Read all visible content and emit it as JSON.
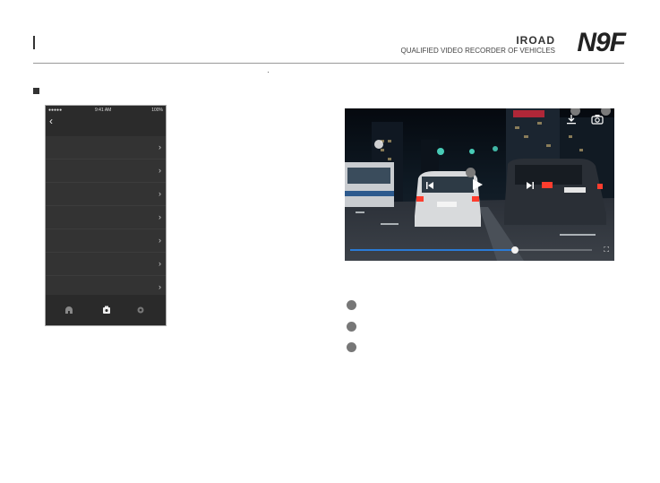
{
  "header": {
    "brand_name": "IROAD",
    "model": "N9F",
    "tagline": "QUALIFIED VIDEO RECORDER OF VEHICLES"
  },
  "phone": {
    "status_left": "●●●●● ",
    "status_time": "9:41 AM",
    "status_battery": "100%",
    "list_rows": 7,
    "tabs": [
      "home-icon",
      "recordings-icon",
      "settings-icon"
    ]
  },
  "video_player": {
    "progress": 0.68,
    "callouts": [
      "",
      ""
    ]
  },
  "bullets": 3,
  "colors": {
    "accent": "#2a7bd6",
    "phone_bg": "#333333"
  }
}
